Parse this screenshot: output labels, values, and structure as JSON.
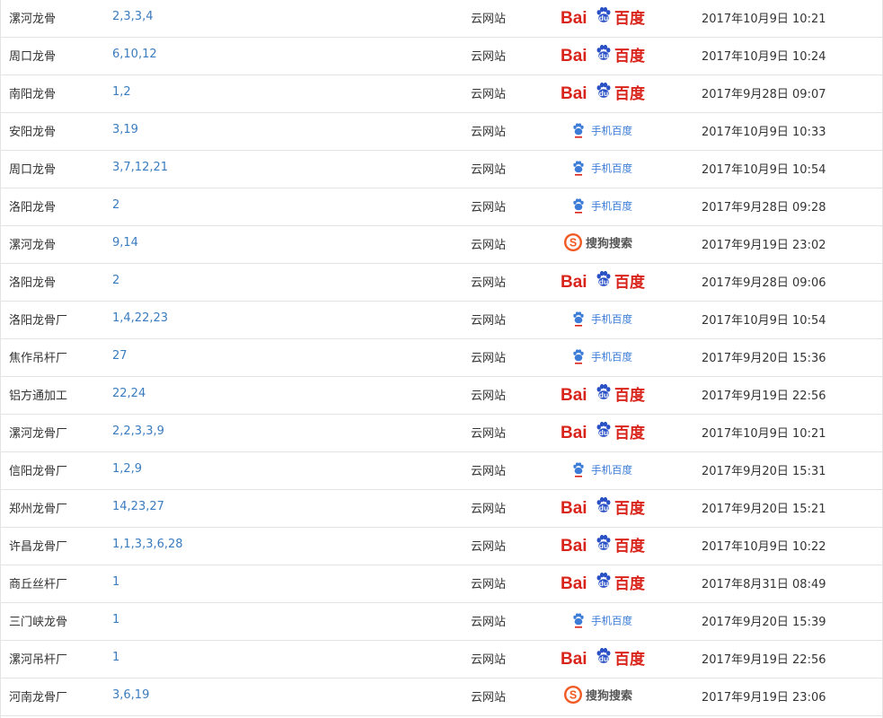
{
  "colors": {
    "baidu_red": "#d9241b",
    "baidu_blue": "#2a50c6",
    "mobile_blue": "#3d7dd8",
    "sogou_orange": "#f15a22",
    "rank_link": "#3a7cbf",
    "border": "#e3e3e3"
  },
  "engines": {
    "baidu": {
      "icon": "baidu-logo-icon",
      "text_left": "Bai",
      "text_paw": "du",
      "text_right": "百度"
    },
    "baidu_mobile": {
      "icon": "baidu-mobile-logo-icon",
      "text": "手机百度"
    },
    "sogou": {
      "icon": "sogou-logo-icon",
      "mark": "S",
      "text": "搜狗搜索"
    }
  },
  "rows": [
    {
      "keyword": "漯河龙骨",
      "rank": "2,3,3,4",
      "site": "云网站",
      "engine": "baidu",
      "time": "2017年10月9日 10:21"
    },
    {
      "keyword": "周口龙骨",
      "rank": "6,10,12",
      "site": "云网站",
      "engine": "baidu",
      "time": "2017年10月9日 10:24"
    },
    {
      "keyword": "南阳龙骨",
      "rank": "1,2",
      "site": "云网站",
      "engine": "baidu",
      "time": "2017年9月28日 09:07"
    },
    {
      "keyword": "安阳龙骨",
      "rank": "3,19",
      "site": "云网站",
      "engine": "baidu_mobile",
      "time": "2017年10月9日 10:33"
    },
    {
      "keyword": "周口龙骨",
      "rank": "3,7,12,21",
      "site": "云网站",
      "engine": "baidu_mobile",
      "time": "2017年10月9日 10:54"
    },
    {
      "keyword": "洛阳龙骨",
      "rank": "2",
      "site": "云网站",
      "engine": "baidu_mobile",
      "time": "2017年9月28日 09:28"
    },
    {
      "keyword": "漯河龙骨",
      "rank": "9,14",
      "site": "云网站",
      "engine": "sogou",
      "time": "2017年9月19日 23:02"
    },
    {
      "keyword": "洛阳龙骨",
      "rank": "2",
      "site": "云网站",
      "engine": "baidu",
      "time": "2017年9月28日 09:06"
    },
    {
      "keyword": "洛阳龙骨厂",
      "rank": "1,4,22,23",
      "site": "云网站",
      "engine": "baidu_mobile",
      "time": "2017年10月9日 10:54"
    },
    {
      "keyword": "焦作吊杆厂",
      "rank": "27",
      "site": "云网站",
      "engine": "baidu_mobile",
      "time": "2017年9月20日 15:36"
    },
    {
      "keyword": "铝方通加工",
      "rank": "22,24",
      "site": "云网站",
      "engine": "baidu",
      "time": "2017年9月19日 22:56"
    },
    {
      "keyword": "漯河龙骨厂",
      "rank": "2,2,3,3,9",
      "site": "云网站",
      "engine": "baidu",
      "time": "2017年10月9日 10:21"
    },
    {
      "keyword": "信阳龙骨厂",
      "rank": "1,2,9",
      "site": "云网站",
      "engine": "baidu_mobile",
      "time": "2017年9月20日 15:31"
    },
    {
      "keyword": "郑州龙骨厂",
      "rank": "14,23,27",
      "site": "云网站",
      "engine": "baidu",
      "time": "2017年9月20日 15:21"
    },
    {
      "keyword": "许昌龙骨厂",
      "rank": "1,1,3,3,6,28",
      "site": "云网站",
      "engine": "baidu",
      "time": "2017年10月9日 10:22"
    },
    {
      "keyword": "商丘丝杆厂",
      "rank": "1",
      "site": "云网站",
      "engine": "baidu",
      "time": "2017年8月31日 08:49"
    },
    {
      "keyword": "三门峡龙骨",
      "rank": "1",
      "site": "云网站",
      "engine": "baidu_mobile",
      "time": "2017年9月20日 15:39"
    },
    {
      "keyword": "漯河吊杆厂",
      "rank": "1",
      "site": "云网站",
      "engine": "baidu",
      "time": "2017年9月19日 22:56"
    },
    {
      "keyword": "河南龙骨厂",
      "rank": "3,6,19",
      "site": "云网站",
      "engine": "sogou",
      "time": "2017年9月19日 23:06"
    }
  ]
}
